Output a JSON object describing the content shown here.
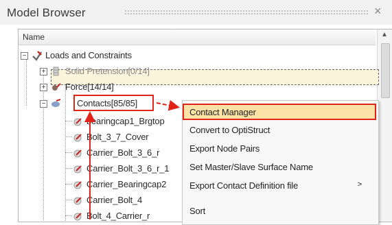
{
  "panel": {
    "title": "Model Browser",
    "close_glyph": "×"
  },
  "tree": {
    "column_header": "Name",
    "items": [
      {
        "label": "Loads and Constraints",
        "icon": "loads-constraints-icon",
        "expander": "−"
      },
      {
        "label": "Solid Pretension[0/14]",
        "icon": "pretension-icon",
        "expander": "+"
      },
      {
        "label": "Force[14/14]",
        "icon": "force-icon",
        "expander": "+"
      },
      {
        "label": "Contacts[85/85]",
        "icon": "contacts-icon",
        "expander": "−"
      },
      {
        "label": "bearingcap1_Brgtop",
        "icon": "contact-pair-icon"
      },
      {
        "label": "Bolt_3_7_Cover",
        "icon": "contact-pair-icon"
      },
      {
        "label": "Carrier_Bolt_3_6_r",
        "icon": "contact-pair-icon"
      },
      {
        "label": "Carrier_Bolt_3_6_r_1",
        "icon": "contact-pair-icon"
      },
      {
        "label": "Carrier_Bearingcap2",
        "icon": "contact-pair-icon"
      },
      {
        "label": "Carrier_Bolt_4",
        "icon": "contact-pair-icon"
      },
      {
        "label": "Bolt_4_Carrier_r",
        "icon": "contact-pair-icon"
      }
    ]
  },
  "context_menu": {
    "items": [
      {
        "label": "Contact Manager"
      },
      {
        "label": "Convert to OptiStruct"
      },
      {
        "label": "Export Node Pairs"
      },
      {
        "label": "Set Master/Slave Surface Name"
      },
      {
        "label": "Export Contact Definition file",
        "submenu_glyph": ">"
      },
      {
        "label": "Sort"
      }
    ]
  },
  "colors": {
    "highlight_red": "#e2231a",
    "menu_highlight": "#fbe3a7",
    "selected_row": "#fdf4dc"
  }
}
